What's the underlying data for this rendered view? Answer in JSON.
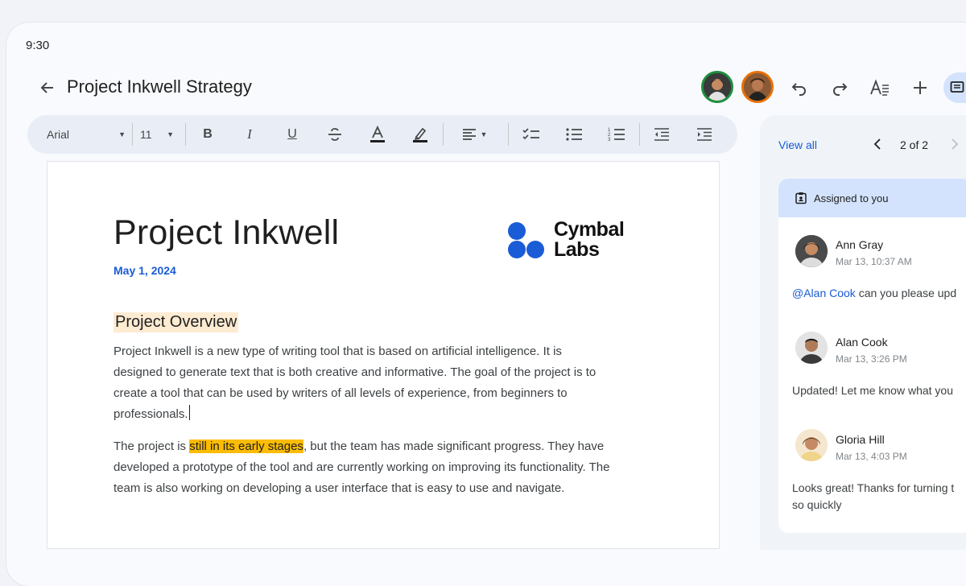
{
  "status": {
    "time": "9:30"
  },
  "header": {
    "title": "Project Inkwell Strategy"
  },
  "toolbar": {
    "font": "Arial",
    "size": "11",
    "bold": "B",
    "italic": "I",
    "underline": "U"
  },
  "document": {
    "title": "Project Inkwell",
    "date": "May 1, 2024",
    "logo_line1": "Cymbal",
    "logo_line2": "Labs",
    "section_heading": "Project Overview",
    "p1_line1": "Project Inkwell is a new type of writing tool that is based on artificial intelligence. It is",
    "p1_line2": "designed to generate text that is both creative and informative. The goal of the project is to",
    "p1_line3": "create a tool that can be used by writers of all levels of experience, from beginners to",
    "p1_line4": "professionals.",
    "p2_before": "The project is ",
    "p2_highlight": "still in its early stages",
    "p2_line1_after": ", but the team has made significant progress. They have",
    "p2_line2": "developed a prototype of the tool and are currently working on improving its functionality. The",
    "p2_line3": "team is also working on developing a user interface that is easy to use and navigate."
  },
  "comments_panel": {
    "view_all": "View all",
    "pager": "2 of 2",
    "assigned_label": "Assigned to you",
    "comments": [
      {
        "name": "Ann Gray",
        "time": "Mar 13, 10:37 AM",
        "mention": "@Alan Cook",
        "text": " can you please upd"
      },
      {
        "name": "Alan Cook",
        "time": "Mar 13, 3:26 PM",
        "text": "Updated! Let me know what you"
      },
      {
        "name": "Gloria Hill",
        "time": "Mar 13, 4:03 PM",
        "text_line1": "Looks great! Thanks for turning t",
        "text_line2": "so quickly"
      }
    ]
  },
  "colors": {
    "accent_blue": "#1a5bd6",
    "highlight_yellow": "#fbbc04",
    "section_highlight": "#fdebd2",
    "toolbar_bg": "#e9eef6",
    "assigned_bg": "#d3e3fd"
  },
  "icons": [
    "back-arrow-icon",
    "undo-icon",
    "redo-icon",
    "text-format-icon",
    "add-icon",
    "comments-icon",
    "font-dropdown-icon",
    "strikethrough-icon",
    "text-color-icon",
    "highlight-icon",
    "align-icon",
    "checklist-icon",
    "bulleted-list-icon",
    "numbered-list-icon",
    "decrease-indent-icon",
    "increase-indent-icon",
    "chevron-left-icon",
    "chevron-right-icon",
    "assignment-icon"
  ]
}
